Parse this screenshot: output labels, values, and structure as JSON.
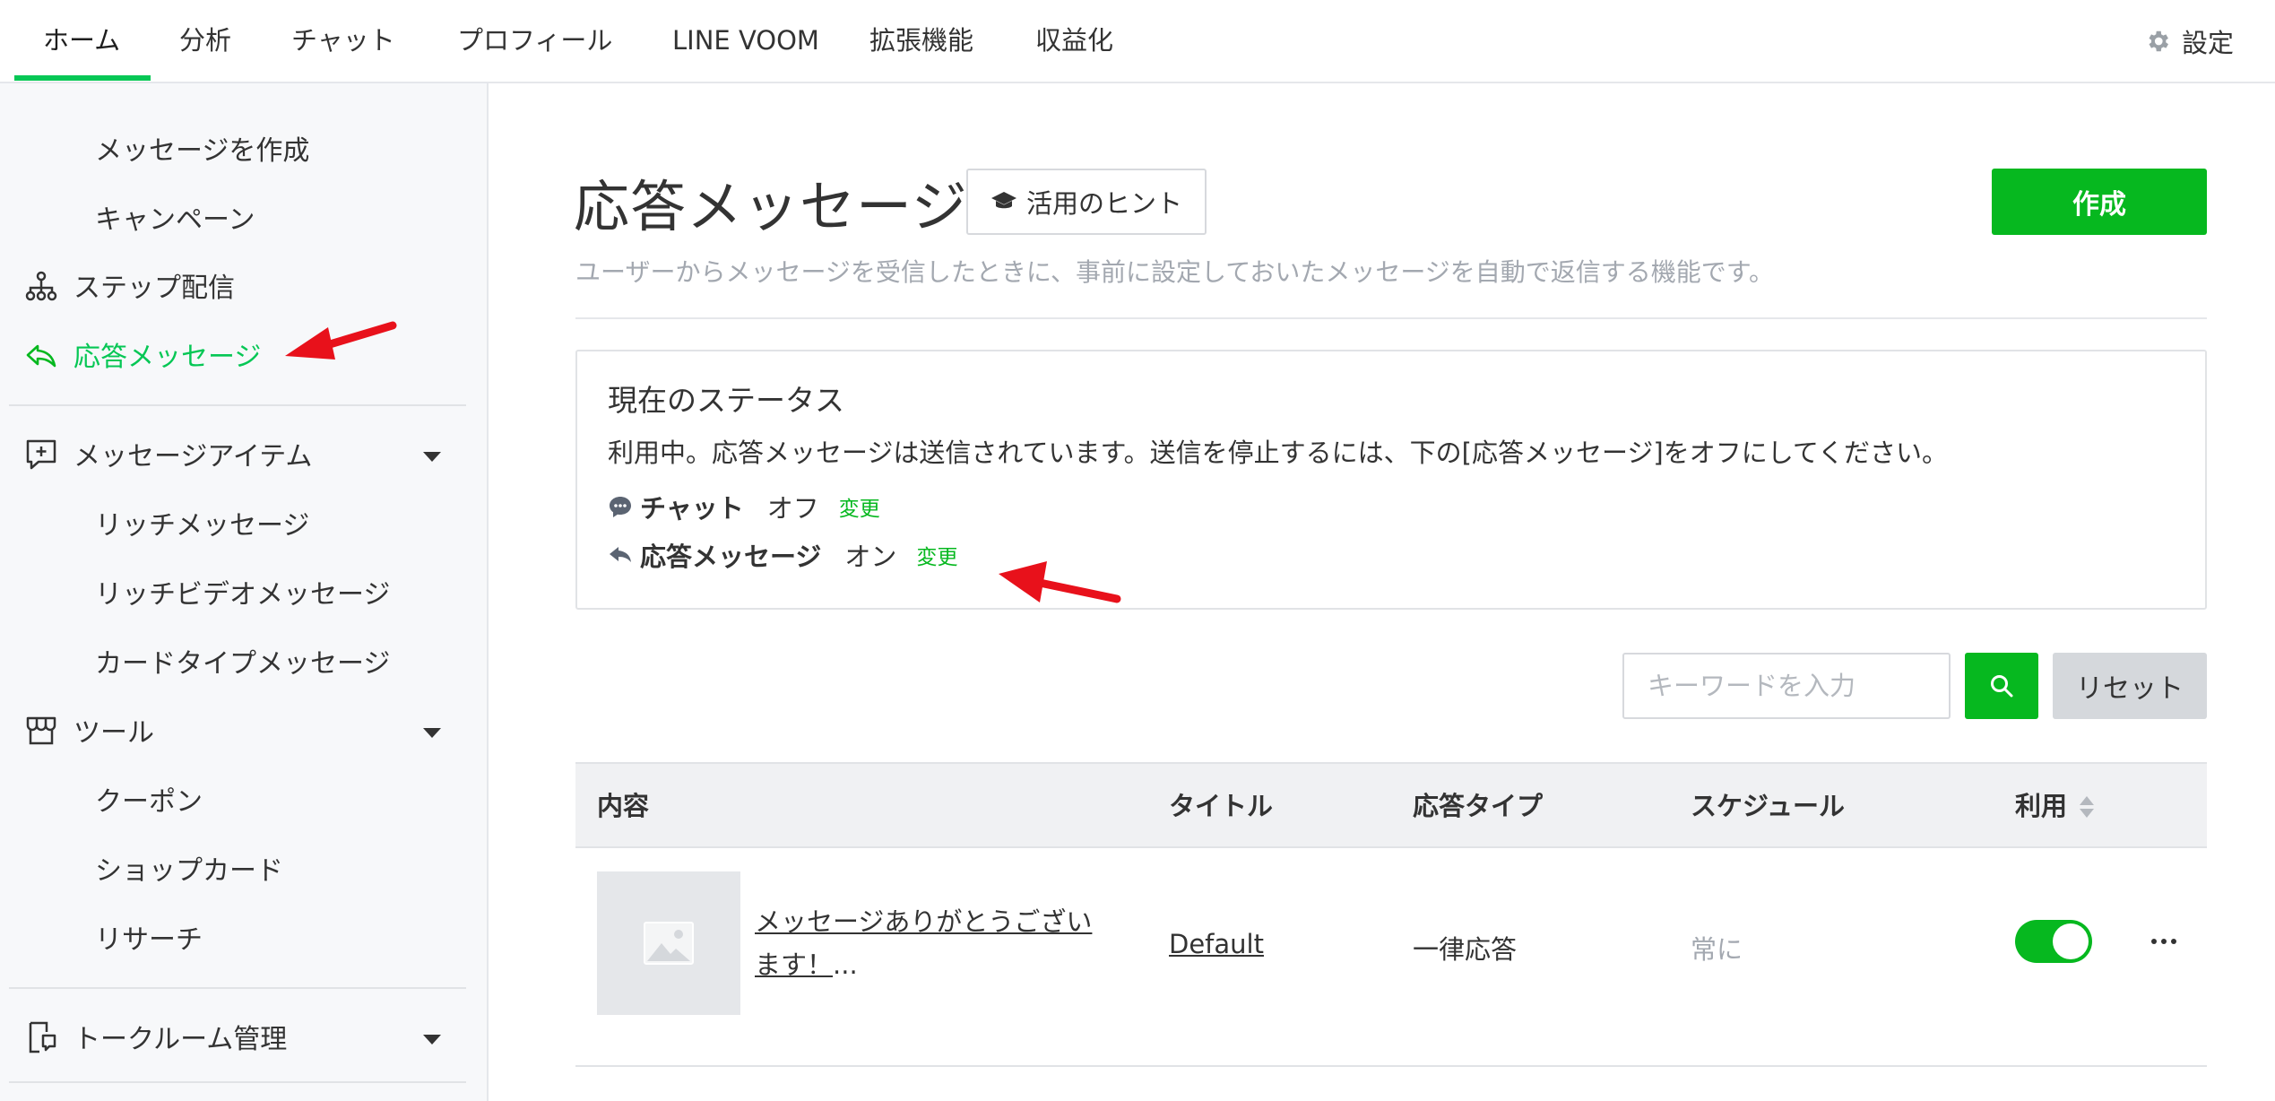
{
  "topnav": {
    "tabs": [
      {
        "label": "ホーム"
      },
      {
        "label": "分析"
      },
      {
        "label": "チャット"
      },
      {
        "label": "プロフィール"
      },
      {
        "label": "LINE VOOM"
      },
      {
        "label": "拡張機能"
      },
      {
        "label": "収益化"
      }
    ],
    "active_tab": "ホーム",
    "settings_label": "設定",
    "settings_icon": "gear-icon"
  },
  "sidebar": {
    "items": [
      {
        "label": "メッセージを作成"
      },
      {
        "label": "キャンペーン"
      },
      {
        "label": "ステップ配信",
        "icon": "step-delivery-icon"
      },
      {
        "label": "応答メッセージ",
        "icon": "reply-icon",
        "active": true
      },
      {
        "label": "メッセージアイテム",
        "icon": "add-message-icon"
      },
      {
        "label": "リッチメッセージ"
      },
      {
        "label": "リッチビデオメッセージ"
      },
      {
        "label": "カードタイプメッセージ"
      },
      {
        "label": "ツール",
        "icon": "store-icon"
      },
      {
        "label": "クーポン"
      },
      {
        "label": "ショップカード"
      },
      {
        "label": "リサーチ"
      },
      {
        "label": "トークルーム管理",
        "icon": "talkroom-icon"
      }
    ]
  },
  "header": {
    "title": "応答メッセージ",
    "hint_label": "活用のヒント",
    "create_label": "作成",
    "subtitle": "ユーザーからメッセージを受信したときに、事前に設定しておいたメッセージを自動で返信する機能です。"
  },
  "status": {
    "title": "現在のステータス",
    "description": "利用中。応答メッセージは送信されています。送信を停止するには、下の[応答メッセージ]をオフにしてください。",
    "rows": [
      {
        "name": "チャット",
        "value": "オフ",
        "change_label": "変更",
        "icon": "chat-bubble-icon"
      },
      {
        "name": "応答メッセージ",
        "value": "オン",
        "change_label": "変更",
        "icon": "reply-icon"
      }
    ]
  },
  "search": {
    "placeholder": "キーワードを入力",
    "reset_label": "リセット"
  },
  "table": {
    "columns": [
      "内容",
      "タイトル",
      "応答タイプ",
      "スケジュール",
      "利用"
    ],
    "rows": [
      {
        "content_line1": "メッセージありがとうござい",
        "content_line2": "ます！",
        "content_ellipsis": "...",
        "title": "Default",
        "type": "一律応答",
        "schedule": "常に",
        "enabled": true
      }
    ]
  },
  "colors": {
    "accent": "#06b81f",
    "annotation_arrow": "#e8111b"
  }
}
